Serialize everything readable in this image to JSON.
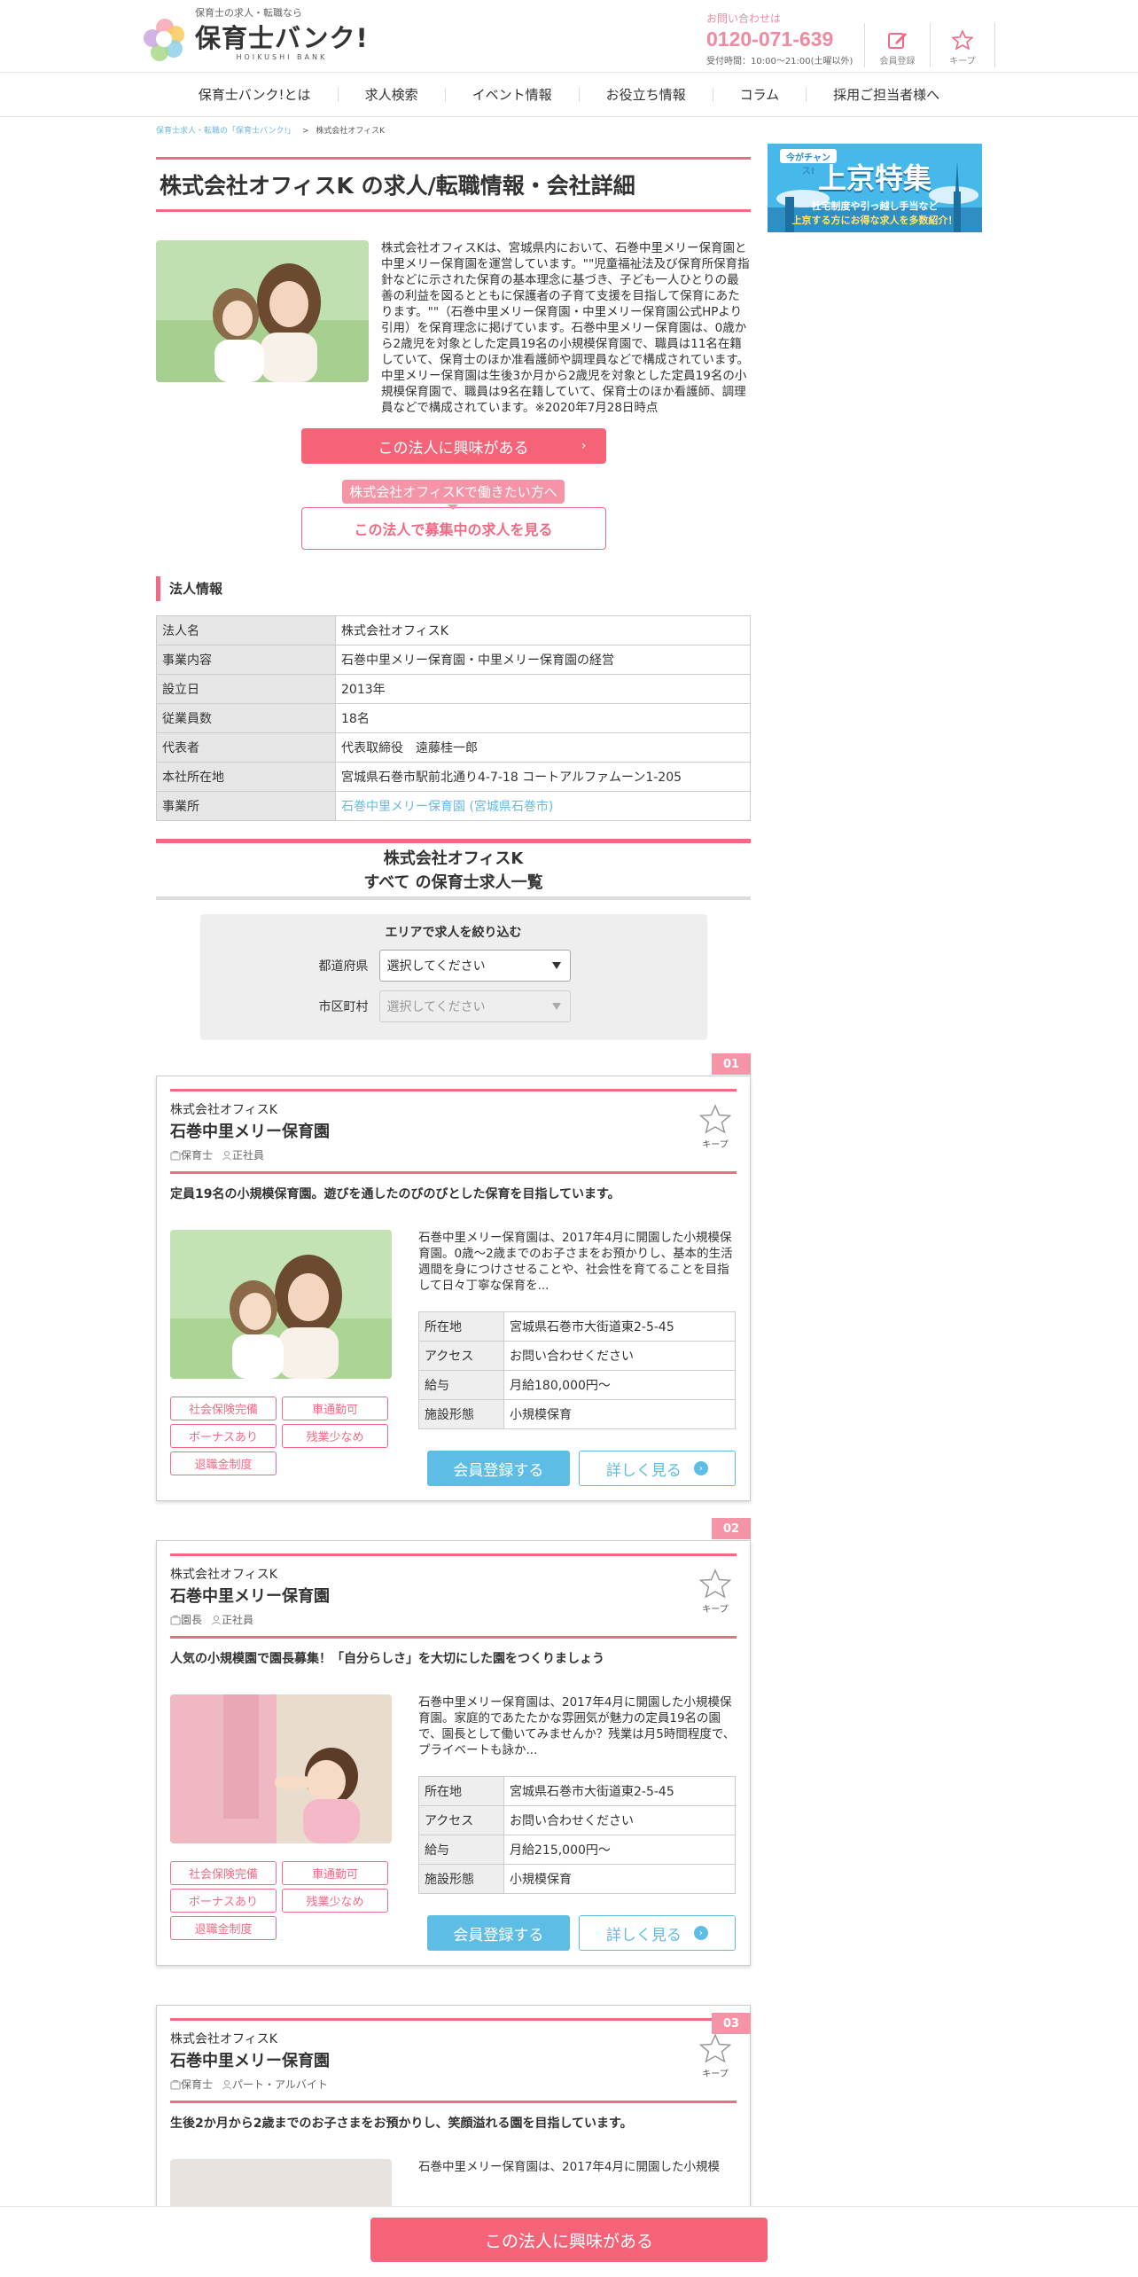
{
  "header": {
    "tagline": "保育士の求人・転職なら",
    "logo_main": "保育士バンク!",
    "logo_sub": "HOIKUSHI BANK",
    "contact_label": "お問い合わせは",
    "contact_phone": "0120-071-639",
    "contact_hours": "受付時間：10:00〜21:00(土曜以外)",
    "register_label": "会員登録",
    "keep_label": "キープ"
  },
  "nav": [
    "保育士バンク!とは",
    "求人検索",
    "イベント情報",
    "お役立ち情報",
    "コラム",
    "採用ご担当者様へ"
  ],
  "breadcrumb": {
    "home": "保育士求人・転職の「保育士バンク!」",
    "sep": ">",
    "current": "株式会社オフィスK"
  },
  "page_title": "株式会社オフィスK の求人/転職情報・会社詳細",
  "intro_text": "株式会社オフィスKは、宮城県内において、石巻中里メリー保育園と中里メリー保育園を運営しています。\"\"児童福祉法及び保育所保育指針などに示された保育の基本理念に基づき、子ども一人ひとりの最善の利益を図るとともに保護者の子育て支援を目指して保育にあたります。\"\"（石巻中里メリー保育園・中里メリー保育園公式HPより引用）を保育理念に掲げています。石巻中里メリー保育園は、0歳から2歳児を対象とした定員19名の小規模保育園で、職員は11名在籍していて、保育士のほか准看護師や調理員などで構成されています。中里メリー保育園は生後3か月から2歳児を対象とした定員19名の小規模保育園で、職員は9名在籍していて、保育士のほか看護師、調理員などで構成されています。※2020年7月28日時点",
  "interest_button": "この法人に興味がある",
  "bubble": "株式会社オフィスKで働きたい方へ",
  "jobs_button": "この法人で募集中の求人を見る",
  "corp_info": {
    "heading": "法人情報",
    "rows": [
      {
        "k": "法人名",
        "v": "株式会社オフィスK"
      },
      {
        "k": "事業内容",
        "v": "石巻中里メリー保育園・中里メリー保育園の経営"
      },
      {
        "k": "設立日",
        "v": "2013年"
      },
      {
        "k": "従業員数",
        "v": "18名"
      },
      {
        "k": "代表者",
        "v": "代表取締役　遠藤桂一郎"
      },
      {
        "k": "本社所在地",
        "v": "宮城県石巻市駅前北通り4-7-18 コートアルファムーン1-205"
      }
    ],
    "office_label": "事業所",
    "office_link": "石巻中里メリー保育園 (宮城県石巻市)"
  },
  "list": {
    "heading_line1": "株式会社オフィスK",
    "heading_line2": "すべて の保育士求人一覧",
    "filter_title": "エリアで求人を絞り込む",
    "pref_label": "都道府県",
    "pref_value": "選択してください",
    "city_label": "市区町村",
    "city_value": "選択してください"
  },
  "job_labels": {
    "keep": "キープ",
    "location": "所在地",
    "access": "アクセス",
    "salary": "給与",
    "facility": "施設形態",
    "register": "会員登録する",
    "detail": "詳しく見る",
    "features": [
      "社会保険完備",
      "車通勤可",
      "ボーナスあり",
      "残業少なめ",
      "退職金制度"
    ]
  },
  "jobs": [
    {
      "num": "01",
      "company": "株式会社オフィスK",
      "name": "石巻中里メリー保育園",
      "role": "保育士",
      "type": "正社員",
      "catch": "定員19名の小規模保育園。遊びを通したのびのびとした保育を目指しています。",
      "desc": "石巻中里メリー保育園は、2017年4月に開園した小規模保育園。0歳～2歳までのお子さまをお預かりし、基本的生活週間を身につけさせることや、社会性を育てることを目指して日々丁寧な保育を...",
      "location": "宮城県石巻市大街道東2-5-45",
      "access": "お問い合わせください",
      "salary": "月給180,000円～",
      "facility": "小規模保育"
    },
    {
      "num": "02",
      "company": "株式会社オフィスK",
      "name": "石巻中里メリー保育園",
      "role": "園長",
      "type": "正社員",
      "catch": "人気の小規模園で園長募集！「自分らしさ」を大切にした園をつくりましょう",
      "desc": "石巻中里メリー保育園は、2017年4月に開園した小規模保育園。家庭的であたたかな雰囲気が魅力の定員19名の園で、園長として働いてみませんか？残業は月5時間程度で、プライベートも詠か...",
      "location": "宮城県石巻市大街道東2-5-45",
      "access": "お問い合わせください",
      "salary": "月給215,000円～",
      "facility": "小規模保育"
    },
    {
      "num": "03",
      "company": "株式会社オフィスK",
      "name": "石巻中里メリー保育園",
      "role": "保育士",
      "type": "パート・アルバイト",
      "catch": "生後2か月から2歳までのお子さまをお預かりし、笑顔溢れる園を目指しています。",
      "desc": "石巻中里メリー保育園は、2017年4月に開園した小規模"
    }
  ],
  "banner": {
    "badge": "今がチャンス!",
    "title": "上京特集",
    "sub1": "社宅制度や引っ越し手当など",
    "sub2": "上京する方にお得な求人を多数紹介！"
  },
  "sticky_button": "この法人に興味がある",
  "colors": {
    "accent": "#f16a84",
    "button": "#f56379",
    "link": "#6cb8e0",
    "blue": "#5ebde4"
  }
}
